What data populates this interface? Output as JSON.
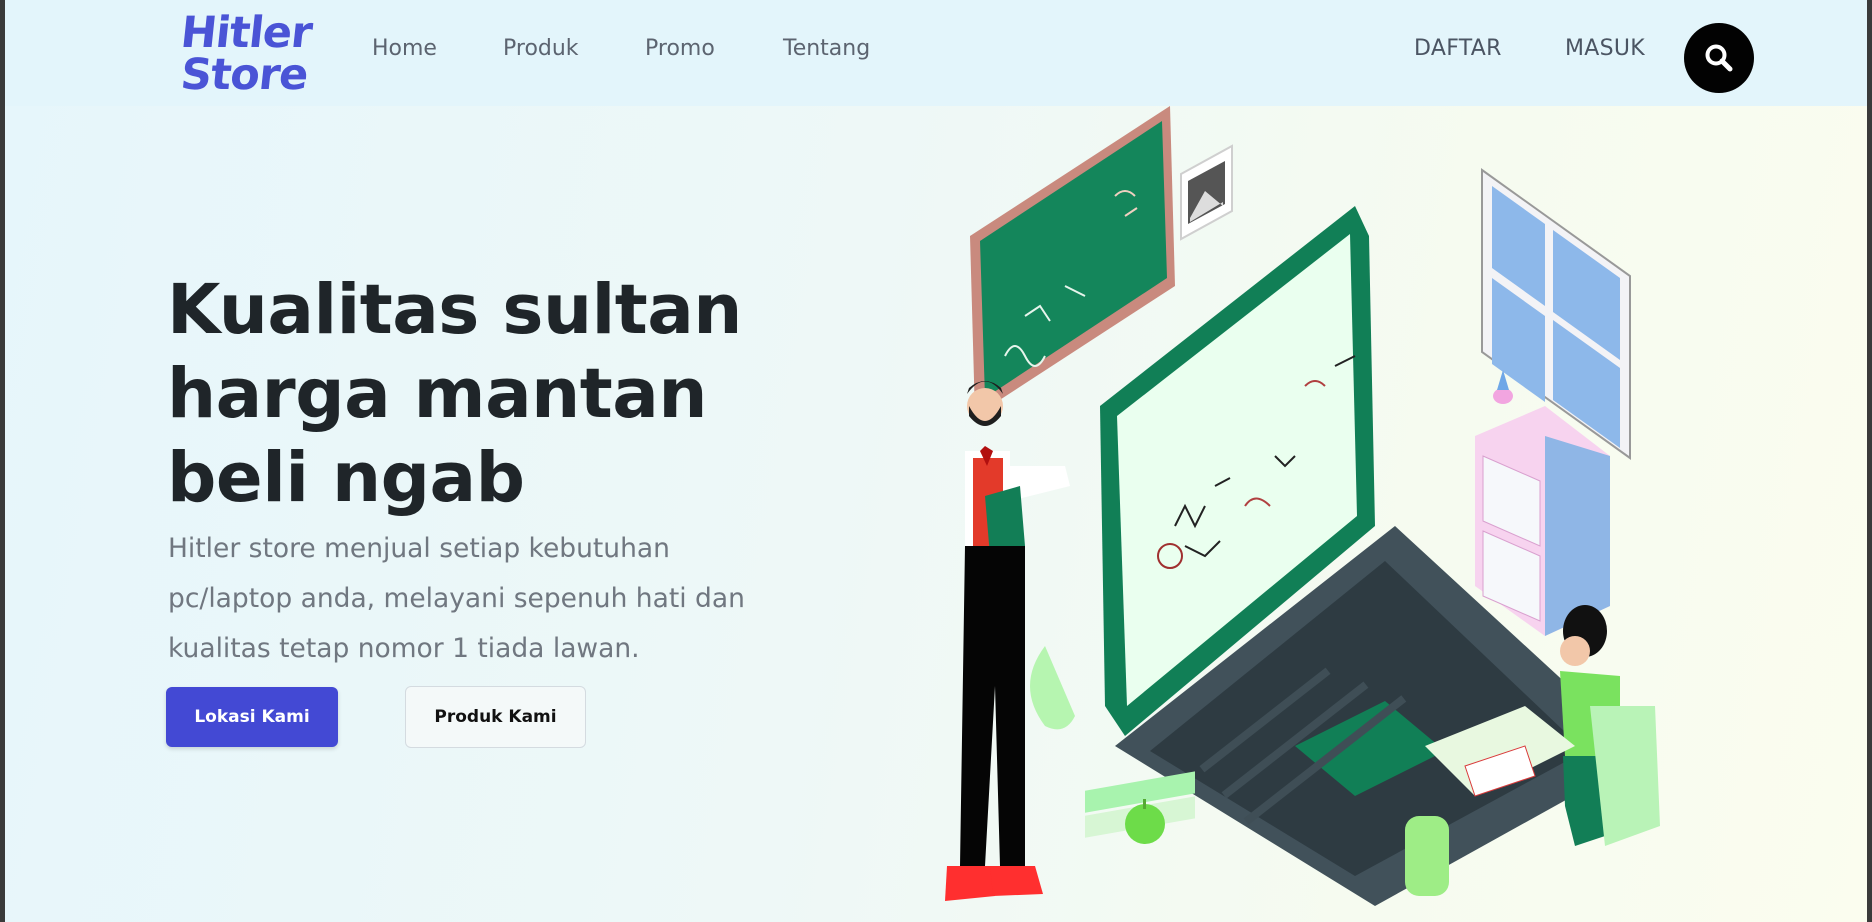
{
  "brand": {
    "line1": "Hitler",
    "line2": "Store"
  },
  "nav": {
    "links": [
      {
        "label": "Home"
      },
      {
        "label": "Produk"
      },
      {
        "label": "Promo"
      },
      {
        "label": "Tentang"
      }
    ],
    "register_label": "DAFTAR",
    "login_label": "MASUK",
    "search_icon": "search-icon"
  },
  "hero": {
    "title_lines": [
      "Kualitas sultan",
      "harga mantan",
      "beli ngab"
    ],
    "description": "Hitler store menjual setiap kebutuhan pc/laptop anda, melayani sepenuh hati dan kualitas tetap nomor 1 tiada lawan.",
    "primary_button": "Lokasi Kami",
    "secondary_button": "Produk Kami"
  },
  "colors": {
    "brand": "#4a54d6",
    "primary_button": "#4349d4",
    "accent_green": "#0f8a5f",
    "search_button": "#020202"
  }
}
